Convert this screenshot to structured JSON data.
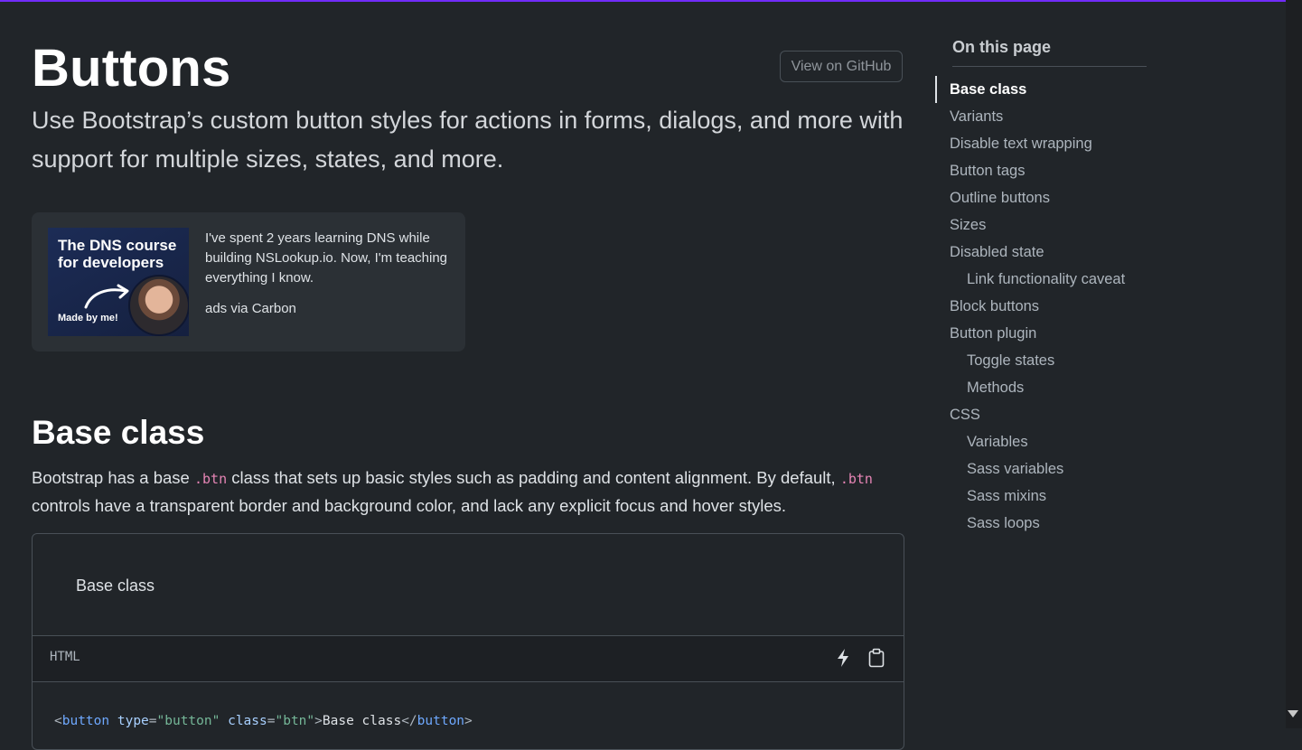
{
  "header": {
    "title": "Buttons",
    "github_button": "View on GitHub",
    "lead": "Use Bootstrap’s custom button styles for actions in forms, dialogs, and more with support for multiple sizes, states, and more."
  },
  "ad": {
    "image_title": "The DNS course for developers",
    "image_caption": "Made by me!",
    "text": "I've spent 2 years learning DNS while building NSLookup.io. Now, I'm teaching everything I know.",
    "via": "ads via Carbon"
  },
  "section": {
    "heading": "Base class",
    "para_1": "Bootstrap has a base ",
    "code_1": ".btn",
    "para_2": " class that sets up basic styles such as padding and content alignment. By default, ",
    "code_2": ".btn",
    "para_3": " controls have a transparent border and background color, and lack any explicit focus and hover styles."
  },
  "example": {
    "button_label": "Base class",
    "lang": "HTML",
    "code": {
      "open_lt": "<",
      "tag": "button",
      "attr1": " type",
      "eq1": "=",
      "val1": "\"button\"",
      "attr2": " class",
      "eq2": "=",
      "val2": "\"btn\"",
      "gt": ">",
      "text": "Base class",
      "close_lt": "</",
      "close_tag": "button",
      "close_gt": ">"
    }
  },
  "toc": {
    "heading": "On this page",
    "items": [
      {
        "label": "Base class"
      },
      {
        "label": "Variants"
      },
      {
        "label": "Disable text wrapping"
      },
      {
        "label": "Button tags"
      },
      {
        "label": "Outline buttons"
      },
      {
        "label": "Sizes"
      },
      {
        "label": "Disabled state"
      },
      {
        "label": "Link functionality caveat"
      },
      {
        "label": "Block buttons"
      },
      {
        "label": "Button plugin"
      },
      {
        "label": "Toggle states"
      },
      {
        "label": "Methods"
      },
      {
        "label": "CSS"
      },
      {
        "label": "Variables"
      },
      {
        "label": "Sass variables"
      },
      {
        "label": "Sass mixins"
      },
      {
        "label": "Sass loops"
      }
    ]
  },
  "colors": {
    "accent": "#712cf9",
    "background": "#212529",
    "code_pink": "#e685b5"
  }
}
